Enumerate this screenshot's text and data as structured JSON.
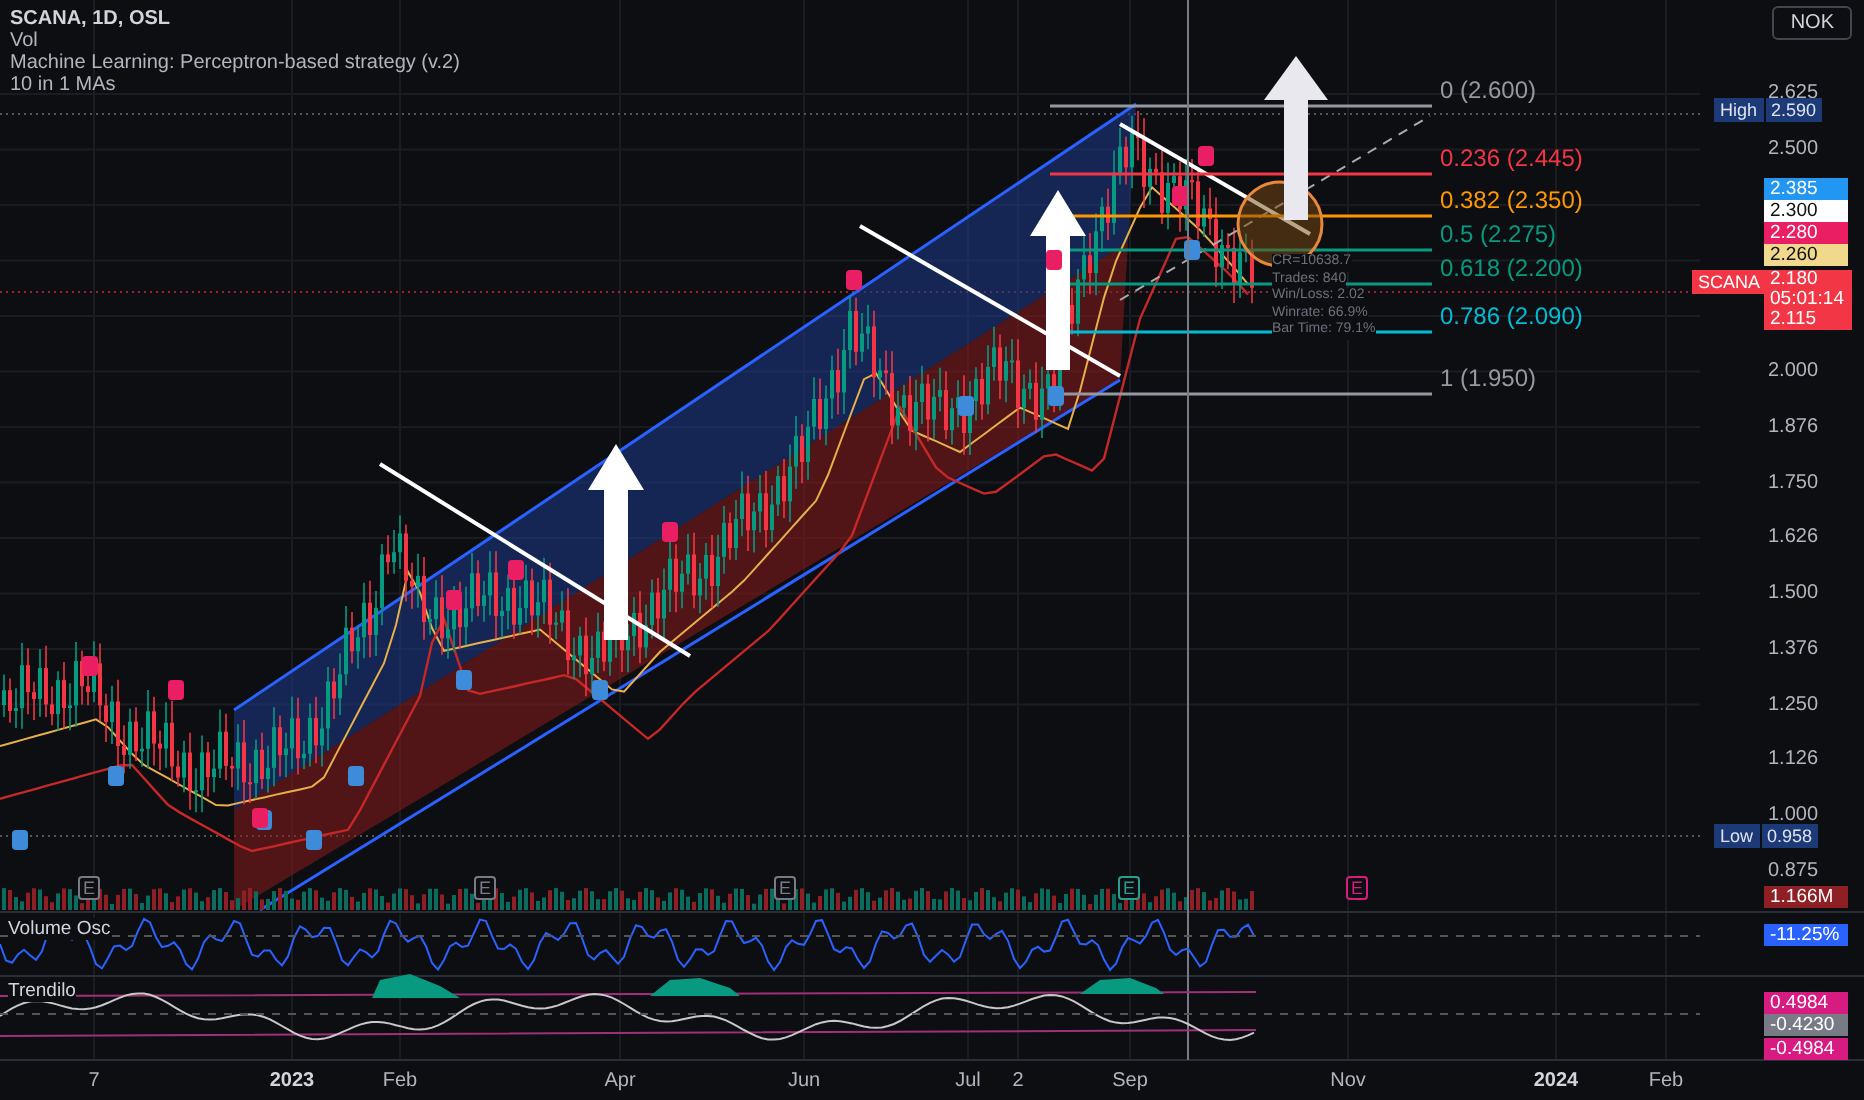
{
  "header": {
    "symbol_line": "SCANA, 1D, OSL",
    "indicators": [
      "Vol",
      "Machine Learning: Perceptron-based strategy (v.2)",
      "10 in 1 MAs"
    ]
  },
  "currency_button": "NOK",
  "price_axis": {
    "upper_ticks": [
      "2.625",
      "2.500"
    ],
    "lower_ticks": [
      "2.000",
      "1.876",
      "1.750",
      "1.626",
      "1.500",
      "1.376",
      "1.250",
      "1.126",
      "1.000",
      "0.875"
    ]
  },
  "fib_levels": [
    {
      "label": "0 (2.600)",
      "color": "#9598a1"
    },
    {
      "label": "0.236 (2.445)",
      "color": "#f23645"
    },
    {
      "label": "0.382 (2.350)",
      "color": "#ff9800"
    },
    {
      "label": "0.5 (2.275)",
      "color": "#089981"
    },
    {
      "label": "0.618 (2.200)",
      "color": "#089981"
    },
    {
      "label": "0.786 (2.090)",
      "color": "#00bcd4"
    },
    {
      "label": "1 (1.950)",
      "color": "#9598a1"
    }
  ],
  "strategy_stats": [
    "CR=10638.7",
    "Trades: 840",
    "Win/Loss: 2.02",
    "Winrate: 66.9%",
    "Bar Time: 79.1%"
  ],
  "axis_badges": [
    {
      "kind": "high",
      "label": "High",
      "value": "2.590",
      "color": "#1c3a78"
    },
    {
      "kind": "plain",
      "value": "2.385",
      "color": "#2196f3"
    },
    {
      "kind": "plain",
      "value": "2.300",
      "color": "#ffffff"
    },
    {
      "kind": "plain",
      "value": "2.280",
      "color": "#e91e63"
    },
    {
      "kind": "plain",
      "value": "2.260",
      "color": "#f0d98c"
    },
    {
      "kind": "last",
      "label": "SCANA",
      "value": "2.180",
      "countdown": "05:01:14",
      "sub_value": "2.115",
      "color": "#f23645"
    },
    {
      "kind": "low",
      "label": "Low",
      "value": "0.958",
      "color": "#1c3a78"
    },
    {
      "kind": "plain",
      "value": "1.166M",
      "color": "#8e1f24"
    },
    {
      "kind": "plain",
      "value": "-11.25%",
      "color": "#2962ff"
    },
    {
      "kind": "plain",
      "value": "0.4984",
      "color": "#d81b80"
    },
    {
      "kind": "plain",
      "value": "-0.4230",
      "color": "#787b86"
    },
    {
      "kind": "plain",
      "value": "-0.4984",
      "color": "#d81b80"
    }
  ],
  "event_markers": [
    {
      "label": "E",
      "color": "#787b86"
    },
    {
      "label": "E",
      "color": "#787b86"
    },
    {
      "label": "E",
      "color": "#787b86"
    },
    {
      "label": "E",
      "color": "#2a9d8f"
    },
    {
      "label": "E",
      "color": "#d81b80"
    }
  ],
  "panes": [
    {
      "title": "Volume Osc"
    },
    {
      "title": "Trendilo"
    }
  ],
  "time_axis": [
    "7",
    "2023",
    "Feb",
    "Apr",
    "Jun",
    "Jul",
    "2",
    "Sep",
    "Nov",
    "2024",
    "Feb"
  ]
}
